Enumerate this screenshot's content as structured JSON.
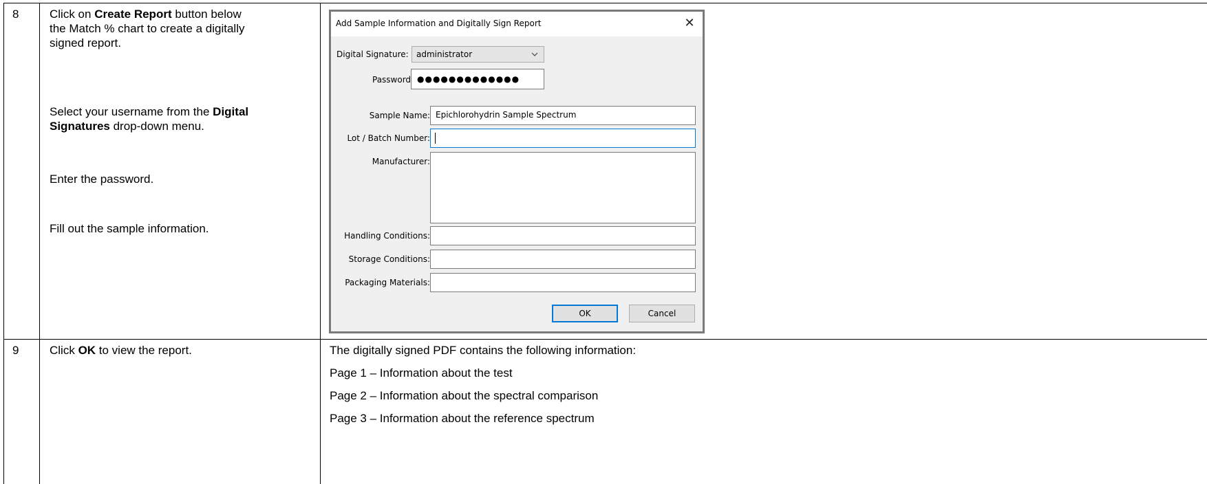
{
  "rows": [
    {
      "step": "8",
      "instructions": {
        "p1_pre": "Click on ",
        "p1_bold": "Create Report",
        "p1_post_l1": " button below",
        "p1_l2": "the Match % chart to create a digitally",
        "p1_l3": "signed report.",
        "p2_pre": "Select your username from the ",
        "p2_bold_l1": "Digital",
        "p2_bold_l2": "Signatures",
        "p2_post": " drop-down menu.",
        "p3": "Enter the password.",
        "p4": "Fill out the sample information."
      }
    },
    {
      "step": "9",
      "instructions": {
        "pre": "Click ",
        "bold": "OK",
        "post": " to view the report."
      },
      "result_lines": [
        "The digitally signed PDF contains the following information:",
        "Page 1 – Information about the test",
        "Page 2 – Information about the spectral comparison",
        "Page 3 – Information about the reference spectrum"
      ]
    }
  ],
  "dialog": {
    "title": "Add Sample Information and Digitally Sign Report",
    "close_glyph": "✕",
    "signature_label": "Digital Signature:",
    "signature_value": "administrator",
    "password_label": "Password:",
    "password_value": "●●●●●●●●●●●●●",
    "sample_name_label": "Sample Name:",
    "sample_name_value": "Epichlorohydrin Sample Spectrum",
    "lot_label": "Lot / Batch Number:",
    "lot_value": "",
    "manufacturer_label": "Manufacturer:",
    "manufacturer_value": "",
    "handling_label": "Handling Conditions:",
    "handling_value": "",
    "storage_label": "Storage Conditions:",
    "storage_value": "",
    "packaging_label": "Packaging Materials:",
    "packaging_value": "",
    "ok_label": "OK",
    "cancel_label": "Cancel"
  },
  "colors": {
    "focus_border": "#0078d7",
    "dialog_border": "#7a7a7a",
    "dialog_bg": "#f0f0f0"
  }
}
